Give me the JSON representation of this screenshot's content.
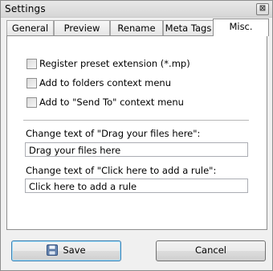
{
  "window": {
    "title": "Settings",
    "close_glyph": "⊠"
  },
  "tabs": [
    {
      "label": "General",
      "active": false
    },
    {
      "label": "Preview",
      "active": false
    },
    {
      "label": "Rename",
      "active": false
    },
    {
      "label": "Meta Tags",
      "active": false
    },
    {
      "label": "Misc.",
      "active": true
    }
  ],
  "options": [
    {
      "label": "Register preset extension (*.mp)",
      "checked": false
    },
    {
      "label": "Add to folders context menu",
      "checked": false
    },
    {
      "label": "Add to \"Send To\" context menu",
      "checked": false
    }
  ],
  "fields": [
    {
      "label": "Change text of \"Drag your files here\":",
      "value": "Drag your files here"
    },
    {
      "label": "Change text of \"Click here to add a rule\":",
      "value": "Click here to add a rule"
    }
  ],
  "buttons": {
    "save": "Save",
    "cancel": "Cancel",
    "save_icon": "floppy-disk-icon"
  }
}
